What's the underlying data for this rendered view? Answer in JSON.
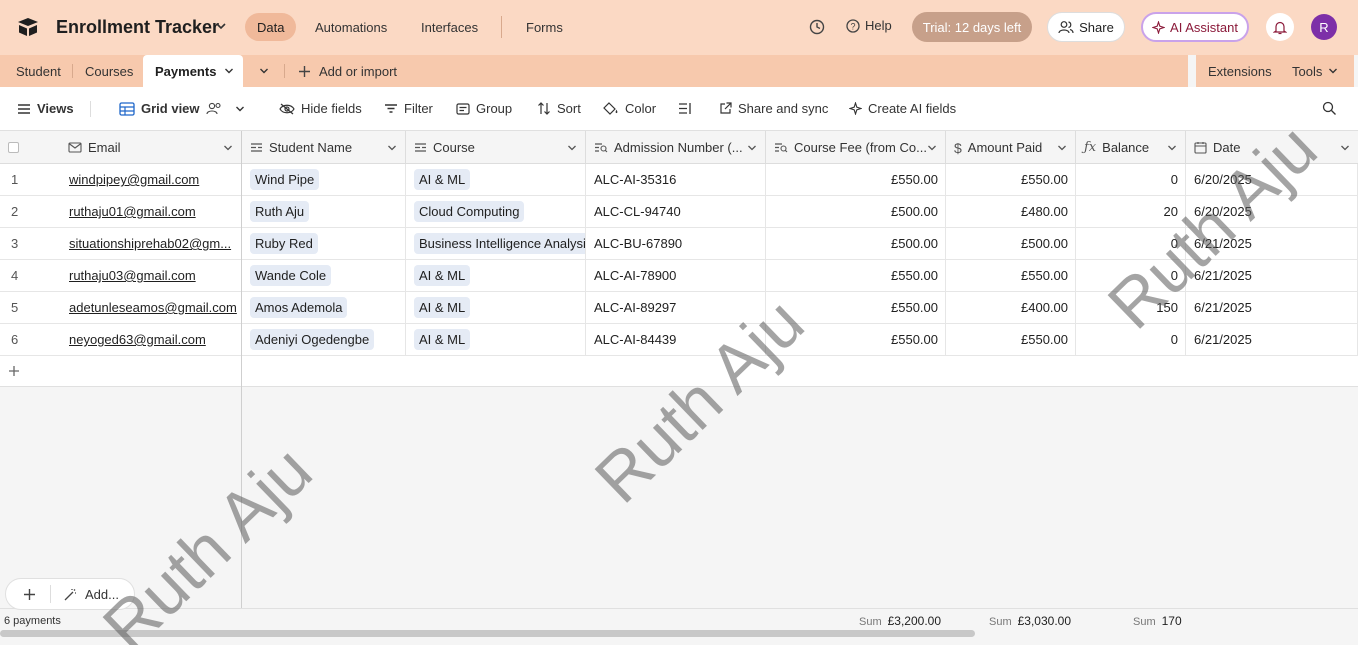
{
  "app": {
    "title": "Enrollment Tracker",
    "nav": [
      "Data",
      "Automations",
      "Interfaces",
      "Forms"
    ],
    "help_label": "Help",
    "trial_label": "Trial: 12 days left",
    "share_label": "Share",
    "ai_label": "AI Assistant",
    "avatar_initial": "R"
  },
  "tabs": {
    "items": [
      "Student",
      "Courses",
      "Payments"
    ],
    "add_label": "Add or import",
    "extensions_label": "Extensions",
    "tools_label": "Tools"
  },
  "toolbar": {
    "views_label": "Views",
    "grid_view_label": "Grid view",
    "hide_fields_label": "Hide fields",
    "filter_label": "Filter",
    "group_label": "Group",
    "sort_label": "Sort",
    "color_label": "Color",
    "share_sync_label": "Share and sync",
    "create_ai_label": "Create AI fields"
  },
  "columns": [
    "Email",
    "Student Name",
    "Course",
    "Admission Number (...",
    "Course Fee (from Co...",
    "Amount Paid",
    "Balance",
    "Date"
  ],
  "rows": [
    {
      "num": "1",
      "email": "windpipey@gmail.com",
      "name": "Wind Pipe",
      "course": "AI & ML",
      "admission": "ALC-AI-35316",
      "fee": "£550.00",
      "paid": "£550.00",
      "balance": "0",
      "date": "6/20/2025"
    },
    {
      "num": "2",
      "email": "ruthaju01@gmail.com",
      "name": "Ruth Aju",
      "course": "Cloud Computing",
      "admission": "ALC-CL-94740",
      "fee": "£500.00",
      "paid": "£480.00",
      "balance": "20",
      "date": "6/20/2025"
    },
    {
      "num": "3",
      "email": "situationshiprehab02@gm...",
      "name": "Ruby Red",
      "course": "Business Intelligence Analysis",
      "admission": "ALC-BU-67890",
      "fee": "£500.00",
      "paid": "£500.00",
      "balance": "0",
      "date": "6/21/2025"
    },
    {
      "num": "4",
      "email": "ruthaju03@gmail.com",
      "name": "Wande Cole",
      "course": "AI & ML",
      "admission": "ALC-AI-78900",
      "fee": "£550.00",
      "paid": "£550.00",
      "balance": "0",
      "date": "6/21/2025"
    },
    {
      "num": "5",
      "email": "adetunleseamos@gmail.com",
      "name": "Amos Ademola",
      "course": "AI & ML",
      "admission": "ALC-AI-89297",
      "fee": "£550.00",
      "paid": "£400.00",
      "balance": "150",
      "date": "6/21/2025"
    },
    {
      "num": "6",
      "email": "neyoged63@gmail.com",
      "name": "Adeniyi Ogedengbe",
      "course": "AI & ML",
      "admission": "ALC-AI-84439",
      "fee": "£550.00",
      "paid": "£550.00",
      "balance": "0",
      "date": "6/21/2025"
    }
  ],
  "footer": {
    "count_label": "6 payments",
    "sum_label": "Sum",
    "fee_sum": "£3,200.00",
    "paid_sum": "£3,030.00",
    "balance_sum": "170",
    "add_label": "Add..."
  },
  "watermark": "Ruth Aju",
  "colors": {
    "header_bg": "#fbd9c4",
    "tab_bg": "#f7c9ad",
    "accent": "#7d2fa8"
  }
}
